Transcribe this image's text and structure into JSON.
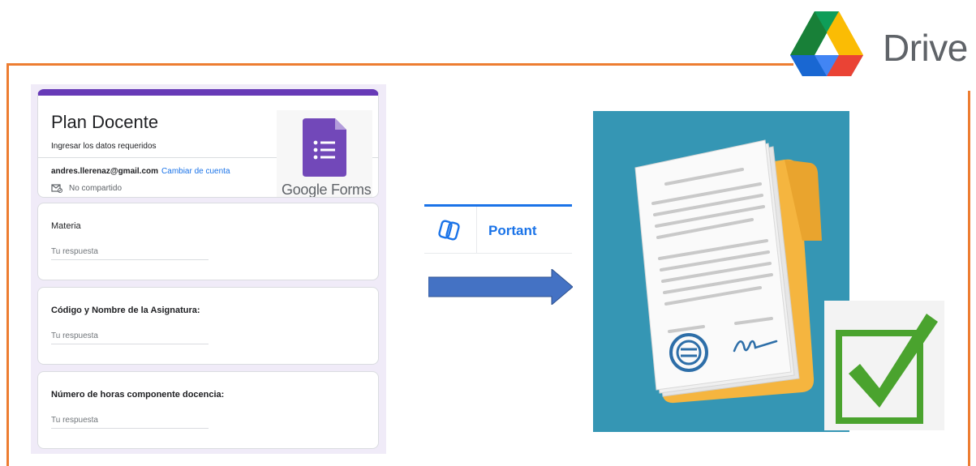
{
  "drive": {
    "label": "Drive",
    "icon": "google-drive-icon"
  },
  "form": {
    "title": "Plan Docente",
    "description": "Ingresar los datos requeridos",
    "account_email": "andres.llerenaz@gmail.com",
    "switch_account": "Cambiar de cuenta",
    "not_shared": "No compartido",
    "accent_color": "#673ab7",
    "logo_label": "Google Forms",
    "questions": [
      {
        "label": "Materia",
        "placeholder": "Tu respuesta"
      },
      {
        "label": "Código y Nombre de la Asignatura:",
        "placeholder": "Tu respuesta"
      },
      {
        "label": "Número de horas componente docencia:",
        "placeholder": "Tu respuesta"
      }
    ]
  },
  "portant": {
    "label": "Portant",
    "color": "#1a73e8"
  },
  "arrow": {
    "icon": "right-arrow-icon",
    "color": "#4472c4"
  },
  "document": {
    "icon": "signed-document-icon",
    "bg_color": "#3596b4"
  },
  "check": {
    "icon": "checkmark-icon",
    "color": "#4aa32e"
  },
  "frame_color": "#ed7d31"
}
